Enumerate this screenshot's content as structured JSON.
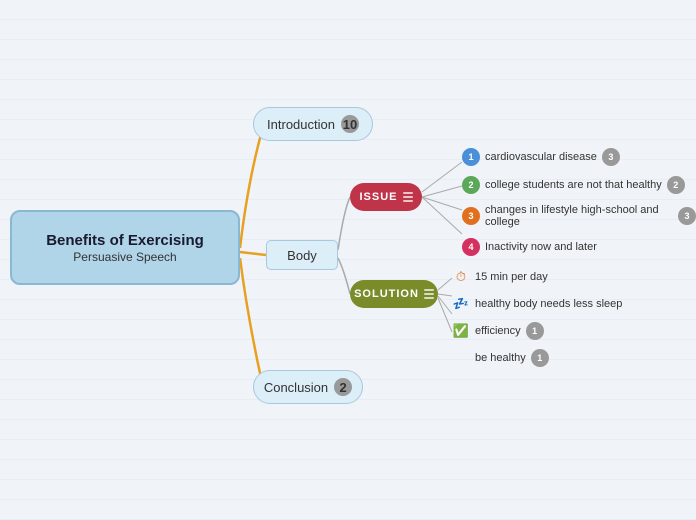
{
  "title": "Benefits of Exercising Persuasive Speech",
  "central": {
    "title": "Benefits of Exercising",
    "subtitle": "Persuasive Speech"
  },
  "introduction": {
    "label": "Introduction",
    "badge": "10"
  },
  "body": {
    "label": "Body"
  },
  "conclusion": {
    "label": "Conclusion",
    "badge": "2"
  },
  "issue": {
    "label": "ISSUE",
    "items": [
      {
        "num": "1",
        "text": "cardiovascular disease",
        "badge": "3"
      },
      {
        "num": "2",
        "text": "college students are not that healthy",
        "badge": "2"
      },
      {
        "num": "3",
        "text": "changes in lifestyle high-school and college",
        "badge": "3"
      },
      {
        "num": "4",
        "text": "Inactivity now and later",
        "badge": ""
      }
    ]
  },
  "solution": {
    "label": "SOLUTION",
    "items": [
      {
        "icon": "clock",
        "text": "15 min per day",
        "badge": ""
      },
      {
        "icon": "sleep",
        "text": "healthy body needs less sleep",
        "badge": ""
      },
      {
        "icon": "check",
        "text": "efficiency",
        "badge": "1"
      },
      {
        "icon": "none",
        "text": "be healthy",
        "badge": "1"
      }
    ]
  }
}
